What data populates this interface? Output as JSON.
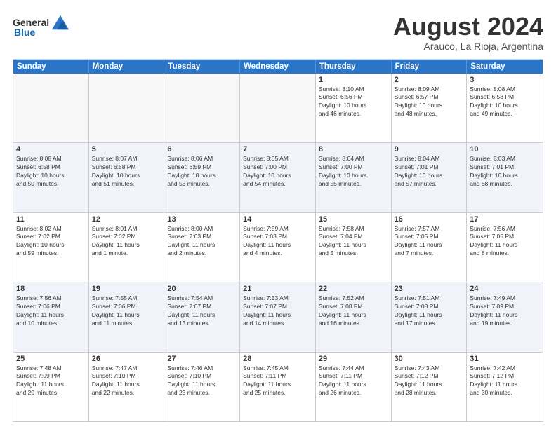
{
  "header": {
    "logo_general": "General",
    "logo_blue": "Blue",
    "month_title": "August 2024",
    "subtitle": "Arauco, La Rioja, Argentina"
  },
  "weekdays": [
    "Sunday",
    "Monday",
    "Tuesday",
    "Wednesday",
    "Thursday",
    "Friday",
    "Saturday"
  ],
  "rows": [
    [
      {
        "day": "",
        "info": "",
        "empty": true
      },
      {
        "day": "",
        "info": "",
        "empty": true
      },
      {
        "day": "",
        "info": "",
        "empty": true
      },
      {
        "day": "",
        "info": "",
        "empty": true
      },
      {
        "day": "1",
        "info": "Sunrise: 8:10 AM\nSunset: 6:56 PM\nDaylight: 10 hours\nand 46 minutes."
      },
      {
        "day": "2",
        "info": "Sunrise: 8:09 AM\nSunset: 6:57 PM\nDaylight: 10 hours\nand 48 minutes."
      },
      {
        "day": "3",
        "info": "Sunrise: 8:08 AM\nSunset: 6:58 PM\nDaylight: 10 hours\nand 49 minutes."
      }
    ],
    [
      {
        "day": "4",
        "info": "Sunrise: 8:08 AM\nSunset: 6:58 PM\nDaylight: 10 hours\nand 50 minutes."
      },
      {
        "day": "5",
        "info": "Sunrise: 8:07 AM\nSunset: 6:58 PM\nDaylight: 10 hours\nand 51 minutes."
      },
      {
        "day": "6",
        "info": "Sunrise: 8:06 AM\nSunset: 6:59 PM\nDaylight: 10 hours\nand 53 minutes."
      },
      {
        "day": "7",
        "info": "Sunrise: 8:05 AM\nSunset: 7:00 PM\nDaylight: 10 hours\nand 54 minutes."
      },
      {
        "day": "8",
        "info": "Sunrise: 8:04 AM\nSunset: 7:00 PM\nDaylight: 10 hours\nand 55 minutes."
      },
      {
        "day": "9",
        "info": "Sunrise: 8:04 AM\nSunset: 7:01 PM\nDaylight: 10 hours\nand 57 minutes."
      },
      {
        "day": "10",
        "info": "Sunrise: 8:03 AM\nSunset: 7:01 PM\nDaylight: 10 hours\nand 58 minutes."
      }
    ],
    [
      {
        "day": "11",
        "info": "Sunrise: 8:02 AM\nSunset: 7:02 PM\nDaylight: 10 hours\nand 59 minutes."
      },
      {
        "day": "12",
        "info": "Sunrise: 8:01 AM\nSunset: 7:02 PM\nDaylight: 11 hours\nand 1 minute."
      },
      {
        "day": "13",
        "info": "Sunrise: 8:00 AM\nSunset: 7:03 PM\nDaylight: 11 hours\nand 2 minutes."
      },
      {
        "day": "14",
        "info": "Sunrise: 7:59 AM\nSunset: 7:03 PM\nDaylight: 11 hours\nand 4 minutes."
      },
      {
        "day": "15",
        "info": "Sunrise: 7:58 AM\nSunset: 7:04 PM\nDaylight: 11 hours\nand 5 minutes."
      },
      {
        "day": "16",
        "info": "Sunrise: 7:57 AM\nSunset: 7:05 PM\nDaylight: 11 hours\nand 7 minutes."
      },
      {
        "day": "17",
        "info": "Sunrise: 7:56 AM\nSunset: 7:05 PM\nDaylight: 11 hours\nand 8 minutes."
      }
    ],
    [
      {
        "day": "18",
        "info": "Sunrise: 7:56 AM\nSunset: 7:06 PM\nDaylight: 11 hours\nand 10 minutes."
      },
      {
        "day": "19",
        "info": "Sunrise: 7:55 AM\nSunset: 7:06 PM\nDaylight: 11 hours\nand 11 minutes."
      },
      {
        "day": "20",
        "info": "Sunrise: 7:54 AM\nSunset: 7:07 PM\nDaylight: 11 hours\nand 13 minutes."
      },
      {
        "day": "21",
        "info": "Sunrise: 7:53 AM\nSunset: 7:07 PM\nDaylight: 11 hours\nand 14 minutes."
      },
      {
        "day": "22",
        "info": "Sunrise: 7:52 AM\nSunset: 7:08 PM\nDaylight: 11 hours\nand 16 minutes."
      },
      {
        "day": "23",
        "info": "Sunrise: 7:51 AM\nSunset: 7:08 PM\nDaylight: 11 hours\nand 17 minutes."
      },
      {
        "day": "24",
        "info": "Sunrise: 7:49 AM\nSunset: 7:09 PM\nDaylight: 11 hours\nand 19 minutes."
      }
    ],
    [
      {
        "day": "25",
        "info": "Sunrise: 7:48 AM\nSunset: 7:09 PM\nDaylight: 11 hours\nand 20 minutes."
      },
      {
        "day": "26",
        "info": "Sunrise: 7:47 AM\nSunset: 7:10 PM\nDaylight: 11 hours\nand 22 minutes."
      },
      {
        "day": "27",
        "info": "Sunrise: 7:46 AM\nSunset: 7:10 PM\nDaylight: 11 hours\nand 23 minutes."
      },
      {
        "day": "28",
        "info": "Sunrise: 7:45 AM\nSunset: 7:11 PM\nDaylight: 11 hours\nand 25 minutes."
      },
      {
        "day": "29",
        "info": "Sunrise: 7:44 AM\nSunset: 7:11 PM\nDaylight: 11 hours\nand 26 minutes."
      },
      {
        "day": "30",
        "info": "Sunrise: 7:43 AM\nSunset: 7:12 PM\nDaylight: 11 hours\nand 28 minutes."
      },
      {
        "day": "31",
        "info": "Sunrise: 7:42 AM\nSunset: 7:12 PM\nDaylight: 11 hours\nand 30 minutes."
      }
    ]
  ]
}
